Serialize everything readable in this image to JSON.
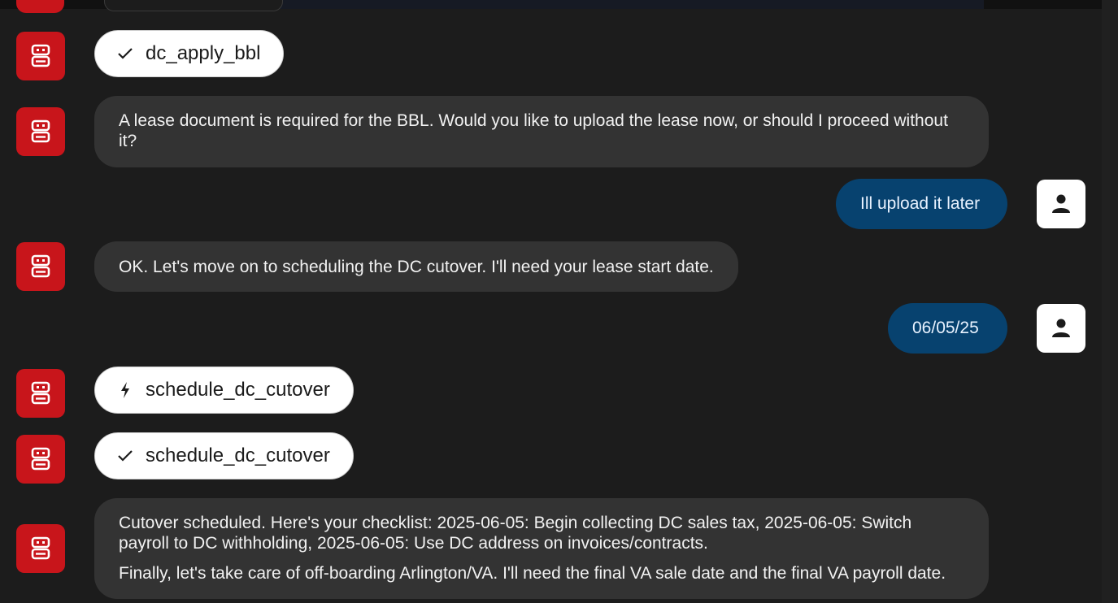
{
  "messages": {
    "m1_tool_done": {
      "label": "dc_apply_bbl"
    },
    "m2_bot": {
      "text": "A lease document is required for the BBL. Would you like to upload the lease now, or should I proceed without it?"
    },
    "m3_user": {
      "text": "Ill upload it later"
    },
    "m4_bot": {
      "text": "OK. Let's move on to scheduling the DC cutover. I'll need your lease start date."
    },
    "m5_user": {
      "text": "06/05/25"
    },
    "m6_tool_running": {
      "label": "schedule_dc_cutover"
    },
    "m7_tool_done": {
      "label": "schedule_dc_cutover"
    },
    "m8_bot": {
      "para1": "Cutover scheduled. Here's your checklist: 2025-06-05: Begin collecting DC sales tax, 2025-06-05: Switch payroll to DC withholding, 2025-06-05: Use DC address on invoices/contracts.",
      "para2": "Finally, let's take care of off-boarding Arlington/VA. I'll need the final VA sale date and the final VA payroll date."
    }
  },
  "icons": {
    "bot_avatar": "robot-icon",
    "user_avatar": "person-icon",
    "tool_done": "checkmark-icon",
    "tool_running": "bolt-icon"
  },
  "colors": {
    "bot_avatar_bg": "#c8151b",
    "user_bubble_bg": "#07426f",
    "bot_bubble_bg": "#333333",
    "page_bg": "#1c1c1c"
  }
}
